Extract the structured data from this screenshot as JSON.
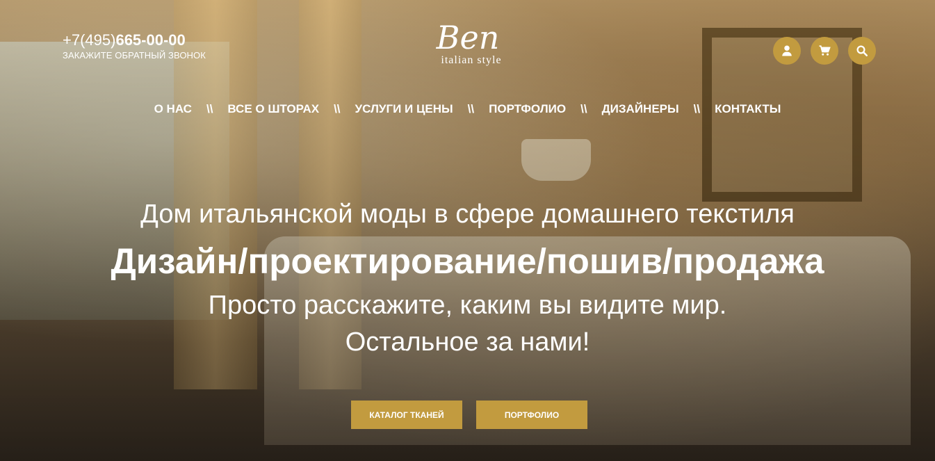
{
  "header": {
    "phone_prefix": "+7(495)",
    "phone_number": "665-00-00",
    "callback_label": "ЗАКАЖИТЕ ОБРАТНЫЙ ЗВОНОК",
    "logo_main": "Ben",
    "logo_sub": "italian style",
    "icons": [
      "user-icon",
      "cart-icon",
      "search-icon"
    ]
  },
  "nav": {
    "separator": "\\\\",
    "items": [
      "О НАС",
      "ВСЕ О ШТОРАХ",
      "УСЛУГИ И ЦЕНЫ",
      "ПОРТФОЛИО",
      "ДИЗАЙНЕРЫ",
      "КОНТАКТЫ"
    ]
  },
  "hero": {
    "headline": "Дом итальянской моды в сфере домашнего текстиля",
    "services": "Дизайн/проектирование/пошив/продажа",
    "tagline": "Просто расскажите, каким вы видите мир. Остальное за нами!"
  },
  "buttons": {
    "catalog": "КАТАЛОГ ТКАНЕЙ",
    "portfolio": "ПОРТФОЛИО"
  },
  "colors": {
    "accent": "#c29b3f"
  }
}
